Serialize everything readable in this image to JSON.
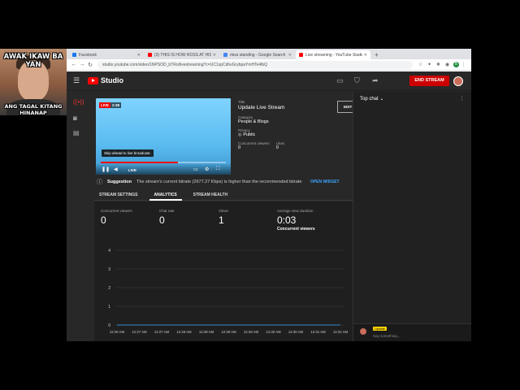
{
  "webcam": {
    "caption_top": "AWAK IKAW BA YAN",
    "caption_bottom": "ANG TAGAL KITANG HINANAP"
  },
  "browser": {
    "tabs": [
      {
        "label": "Facebook",
        "color": "#1877f2",
        "active": false
      },
      {
        "label": "(3) THIS IS HOW ROSS AT HIS I...",
        "color": "#ff0000",
        "active": false
      },
      {
        "label": "miss standing - Google Search",
        "color": "#4285f4",
        "active": false
      },
      {
        "label": "Live streaming - YouTube Studio",
        "color": "#ff0000",
        "active": true
      }
    ],
    "new_tab": "+",
    "url": "studio.youtube.com/video/1NPSOD_bTRo/livestreaming?c=UC1xpCdhvGrybpaYmHTe4lbQ",
    "profile_initial": "B"
  },
  "studio": {
    "brand": "Studio",
    "end_stream": "END STREAM",
    "player": {
      "live_badge": "LIVE",
      "time": "2:38",
      "tooltip": "Skip ahead to live broadcast.",
      "live_label": "LIVE",
      "progress": 0.62
    },
    "info": {
      "title_label": "Title",
      "title": "Update Live Stream",
      "category_label": "Category",
      "category": "People & Blogs",
      "privacy_label": "Privacy",
      "privacy": "Public",
      "concurrent_label": "Concurrent viewers",
      "concurrent": "0",
      "likes_label": "Likes",
      "likes": "0",
      "edit": "EDIT"
    },
    "suggestion": {
      "title": "Suggestion",
      "message": "The stream's current bitrate (2677.27 Kbps) is higher than the recommended bitrate",
      "action": "OPEN WIDGET"
    },
    "tabs": [
      "STREAM SETTINGS",
      "ANALYTICS",
      "STREAM HEALTH"
    ],
    "active_tab": 1,
    "metrics": [
      {
        "label": "Concurrent viewers",
        "value": "0"
      },
      {
        "label": "Chat rate",
        "value": "0"
      },
      {
        "label": "Views",
        "value": "1"
      },
      {
        "label": "Average view duration",
        "value": "0:03",
        "sub": "Concurrent viewers"
      }
    ],
    "chat": {
      "title": "Top chat",
      "username": "Update",
      "placeholder": "Say something..."
    }
  },
  "chart_data": {
    "type": "line",
    "title": "Concurrent viewers",
    "x": [
      "12:26 AM",
      "12:27 AM",
      "12:27 AM",
      "12:28 AM",
      "12:28 AM",
      "12:29 AM",
      "12:29 AM",
      "12:30 AM",
      "12:30 AM",
      "12:31 AM",
      "12:31 AM"
    ],
    "y_ticks": [
      "0",
      "1",
      "2",
      "3",
      "4"
    ],
    "ylim": [
      0,
      4
    ],
    "series": [
      {
        "values": [
          0,
          0,
          0,
          0,
          0,
          0,
          0,
          0,
          0,
          0,
          0
        ]
      }
    ],
    "grid": true
  }
}
